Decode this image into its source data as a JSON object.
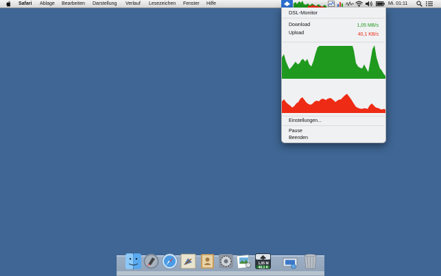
{
  "menubar": {
    "app_name": "Safari",
    "menus": [
      "Ablage",
      "Bearbeiten",
      "Darstellung",
      "Verlauf",
      "Lesezeichen",
      "Fenster",
      "Hilfe"
    ],
    "clock": "Mi. 01:11"
  },
  "dropdown": {
    "title": "DSL-Monitor",
    "download_label": "Download",
    "download_value": "1,05 MB/s",
    "upload_label": "Upload",
    "upload_value": "40,1 KB/s",
    "settings_label": "Einstellungen...",
    "pause_label": "Pause",
    "quit_label": "Beenden",
    "colors": {
      "download": "#1f9a1f",
      "upload": "#ee2b14"
    }
  },
  "dock": {
    "badge_download": "1,05 M",
    "badge_upload": "40,1 K",
    "icons": [
      "finder-icon",
      "launchpad-icon",
      "safari-icon",
      "mail-icon",
      "contacts-icon",
      "system-preferences-icon",
      "preview-icon",
      "dsl-monitor-icon",
      "downloads-icon",
      "trash-icon"
    ]
  }
}
